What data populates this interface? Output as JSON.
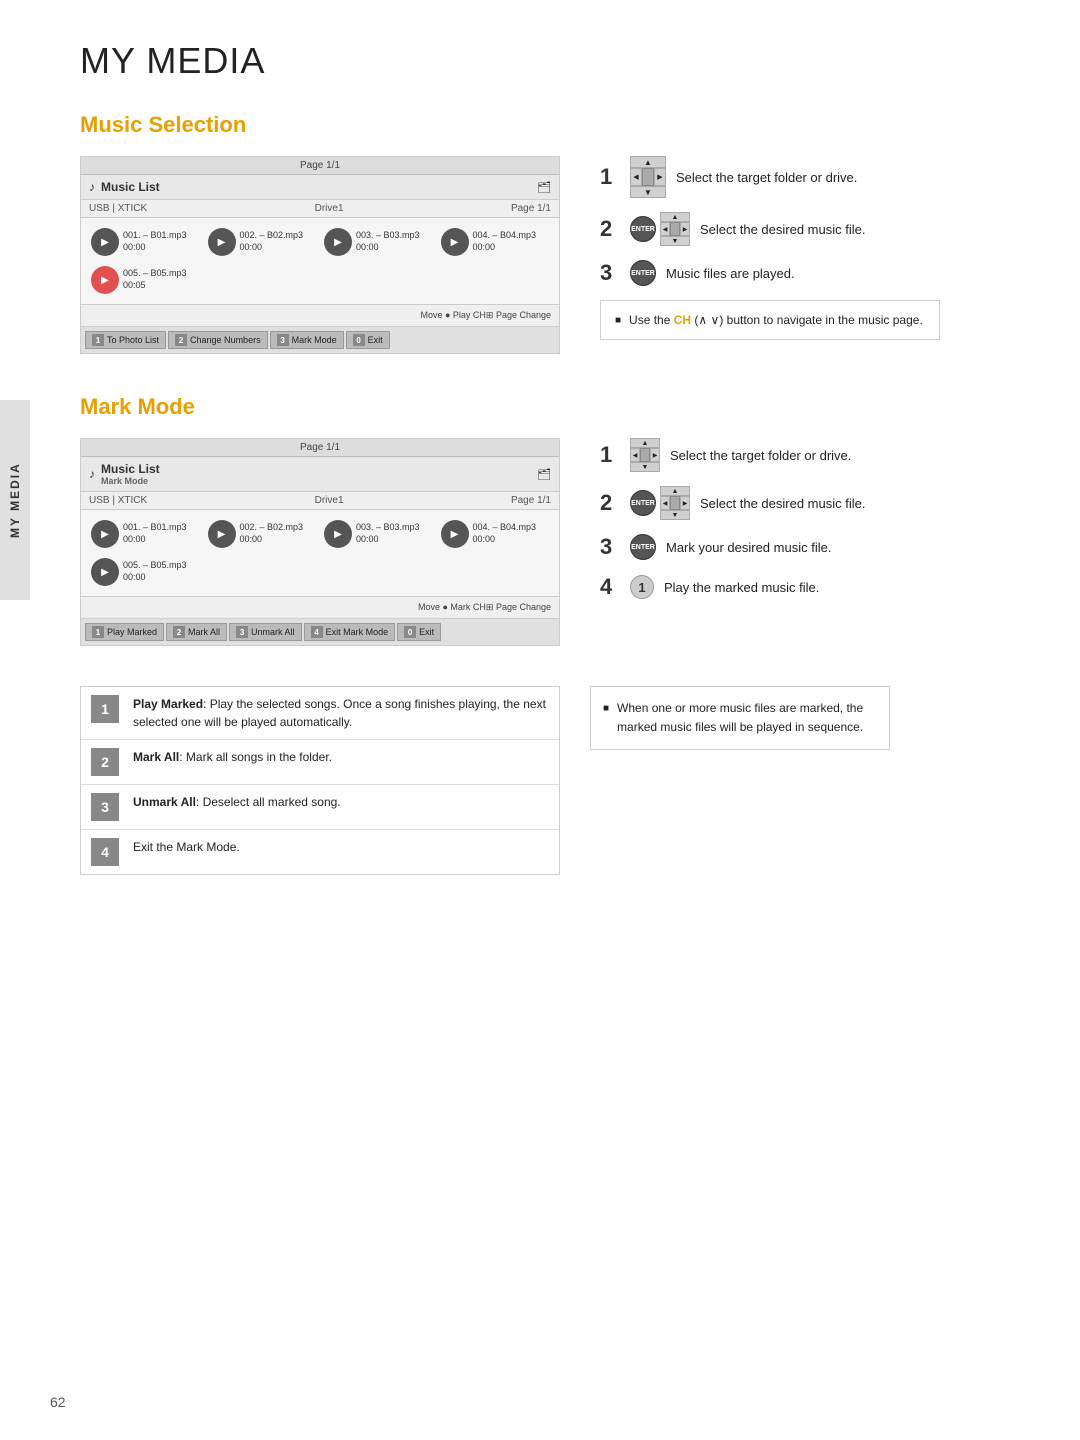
{
  "page": {
    "title": "MY MEDIA",
    "sidebar_label": "MY MEDIA",
    "page_number": "62"
  },
  "music_selection": {
    "section_title": "Music  Selection",
    "panel": {
      "top_bar": "Page 1/1",
      "header_title": "Music List",
      "folder_label": "Drive1",
      "page_label": "Page 1/1",
      "source_label": "USB | XTICK",
      "items": [
        {
          "label": "001. – B01.mp3",
          "time": "00:00",
          "active": false
        },
        {
          "label": "002. – B02.mp3",
          "time": "00:00",
          "active": false
        },
        {
          "label": "003. – B03.mp3",
          "time": "00:00",
          "active": false
        },
        {
          "label": "004. – B04.mp3",
          "time": "00:00",
          "active": false
        },
        {
          "label": "005. – B05.mp3",
          "time": "00:05",
          "active": true
        }
      ],
      "controls": "Move   ● Play   CH⊞ Page Change",
      "footer_buttons": [
        {
          "num": "1",
          "label": "To Photo List"
        },
        {
          "num": "2",
          "label": "Change Numbers"
        },
        {
          "num": "3",
          "label": "Mark Mode"
        },
        {
          "num": "0",
          "label": "Exit"
        }
      ]
    },
    "steps": [
      {
        "num": "1",
        "text": "Select the target folder or drive."
      },
      {
        "num": "2",
        "text": "Select the desired music file."
      },
      {
        "num": "3",
        "text": "Music files are played."
      }
    ],
    "note": "Use the CH (∧ ∨) button to navigate in the music page.",
    "note_ch": "CH"
  },
  "mark_mode": {
    "section_title": "Mark Mode",
    "panel": {
      "top_bar": "Page 1/1",
      "header_title": "Music List",
      "mark_mode_sublabel": "Mark Mode",
      "folder_label": "Drive1",
      "page_label": "Page 1/1",
      "source_label": "USB | XTICK",
      "items": [
        {
          "label": "001. – B01.mp3",
          "time": "00:00",
          "active": false
        },
        {
          "label": "002. – B02.mp3",
          "time": "00:00",
          "active": false
        },
        {
          "label": "003. – B03.mp3",
          "time": "00:00",
          "active": false
        },
        {
          "label": "004. – B04.mp3",
          "time": "00:00",
          "active": false
        },
        {
          "label": "005. – B05.mp3",
          "time": "00:00",
          "active": false
        }
      ],
      "controls": "Move   ● Mark   CH⊞ Page Change",
      "footer_buttons": [
        {
          "num": "1",
          "label": "Play Marked"
        },
        {
          "num": "2",
          "label": "Mark All"
        },
        {
          "num": "3",
          "label": "Unmark All"
        },
        {
          "num": "4",
          "label": "Exit Mark Mode"
        },
        {
          "num": "0",
          "label": "Exit"
        }
      ]
    },
    "steps": [
      {
        "num": "1",
        "text": "Select the target folder or drive."
      },
      {
        "num": "2",
        "text": "Select the desired music file."
      },
      {
        "num": "3",
        "text": "Mark your desired music file."
      },
      {
        "num": "4",
        "text": "Play the marked music file."
      }
    ]
  },
  "key_table": {
    "rows": [
      {
        "num": "1",
        "text_bold": "Play Marked",
        "text": ": Play the selected songs. Once a song finishes playing, the next selected one will be played automatically."
      },
      {
        "num": "2",
        "text_bold": "Mark All",
        "text": ": Mark all songs in the folder."
      },
      {
        "num": "3",
        "text_bold": "Unmark All",
        "text": ": Deselect all marked song."
      },
      {
        "num": "4",
        "text_bold": "",
        "text": "Exit the Mark Mode."
      }
    ]
  },
  "mark_note": "When one or more music files are marked, the marked music files will be played in sequence."
}
